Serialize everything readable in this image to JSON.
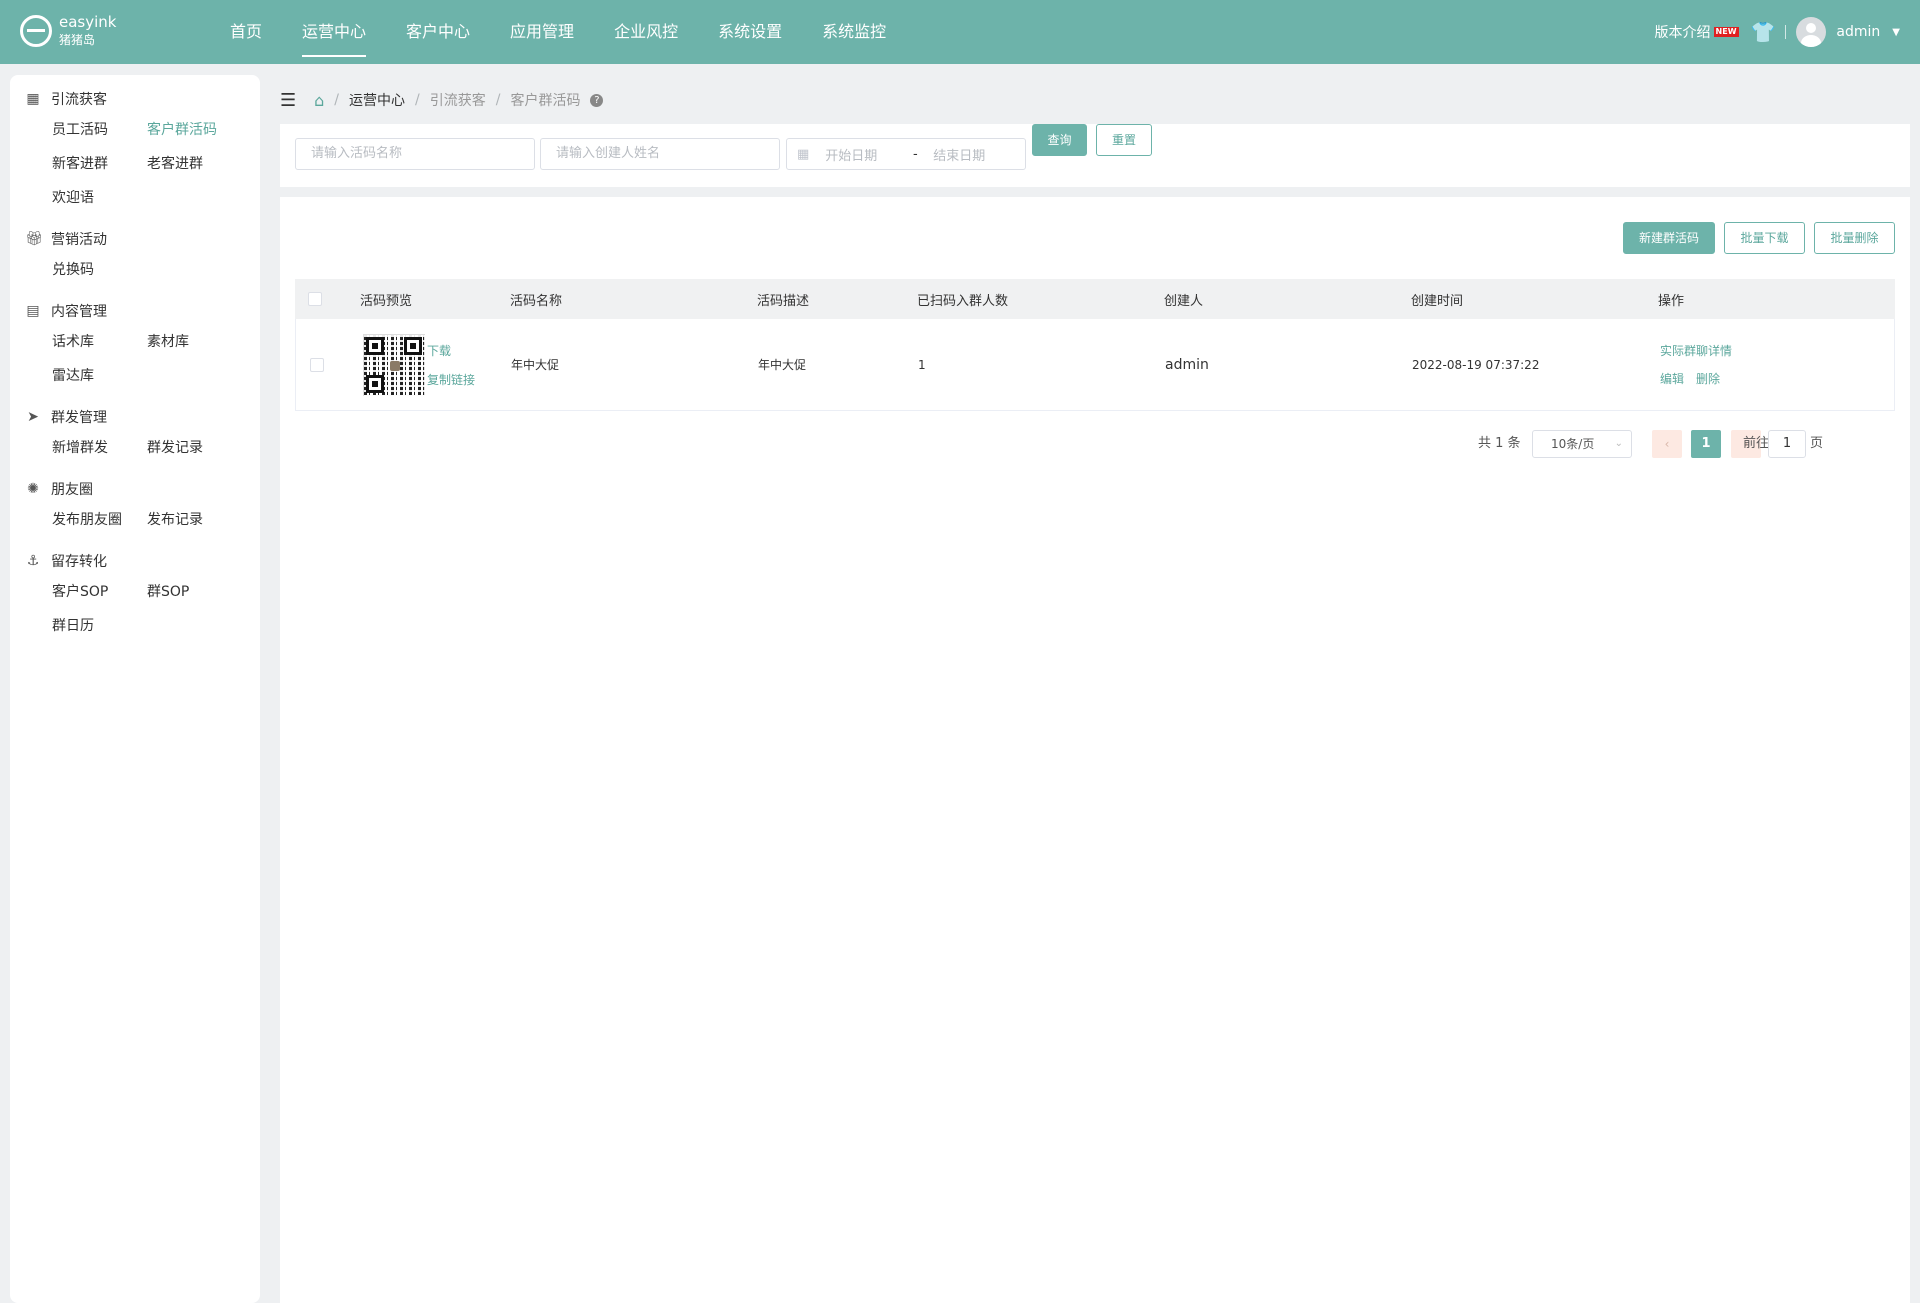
{
  "header": {
    "logo_name": "easyink",
    "logo_sub": "猪猪岛",
    "nav": [
      "首页",
      "运营中心",
      "客户中心",
      "应用管理",
      "企业风控",
      "系统设置",
      "系统监控"
    ],
    "active_nav": "运营中心",
    "version_label": "版本介绍",
    "new_badge": "NEW",
    "user_name": "admin",
    "brand_color": "#6db3aa"
  },
  "sidebar": {
    "groups": [
      {
        "title": "引流获客",
        "icon": "grid-icon",
        "items": [
          "员工活码",
          "客户群活码",
          "新客进群",
          "老客进群",
          "欢迎语"
        ]
      },
      {
        "title": "营销活动",
        "icon": "gift-icon",
        "items": [
          "兑换码"
        ]
      },
      {
        "title": "内容管理",
        "icon": "document-icon",
        "items": [
          "话术库",
          "素材库",
          "雷达库"
        ]
      },
      {
        "title": "群发管理",
        "icon": "send-icon",
        "items": [
          "新增群发",
          "群发记录"
        ]
      },
      {
        "title": "朋友圈",
        "icon": "aperture-icon",
        "items": [
          "发布朋友圈",
          "发布记录"
        ]
      },
      {
        "title": "留存转化",
        "icon": "anchor-icon",
        "items": [
          "客户SOP",
          "群SOP",
          "群日历"
        ]
      }
    ],
    "active_item": "客户群活码"
  },
  "breadcrumb": {
    "items": [
      "运营中心",
      "引流获客",
      "客户群活码"
    ]
  },
  "search": {
    "name_placeholder": "请输入活码名称",
    "creator_placeholder": "请输入创建人姓名",
    "start_placeholder": "开始日期",
    "range_separator": "-",
    "end_placeholder": "结束日期",
    "query_label": "查询",
    "reset_label": "重置"
  },
  "actions": {
    "create_label": "新建群活码",
    "batch_download_label": "批量下载",
    "batch_delete_label": "批量删除"
  },
  "table": {
    "columns": [
      "活码预览",
      "活码名称",
      "活码描述",
      "已扫码入群人数",
      "创建人",
      "创建时间",
      "操作"
    ],
    "rows": [
      {
        "download_label": "下载",
        "copy_link_label": "复制链接",
        "name": "年中大促",
        "description": "年中大促",
        "scanned_count": "1",
        "creator": "admin",
        "created_at": "2022-08-19 07:37:22",
        "detail_label": "实际群聊详情",
        "edit_label": "编辑",
        "delete_label": "删除"
      }
    ]
  },
  "pagination": {
    "total_text": "共 1 条",
    "page_size": "10条/页",
    "current_page": "1",
    "goto_label": "前往",
    "goto_value": "1",
    "page_unit": "页"
  }
}
